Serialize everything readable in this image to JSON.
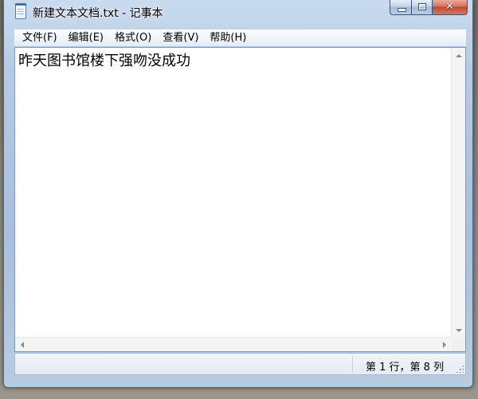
{
  "window": {
    "title": "新建文本文档.txt - 记事本",
    "close_glyph": "✕"
  },
  "menu": {
    "items": [
      {
        "label": "文件(F)"
      },
      {
        "label": "编辑(E)"
      },
      {
        "label": "格式(O)"
      },
      {
        "label": "查看(V)"
      },
      {
        "label": "帮助(H)"
      }
    ]
  },
  "editor": {
    "content": "昨天图书馆楼下强吻没成功"
  },
  "statusbar": {
    "position": "第 1 行，第 8 列"
  },
  "colors": {
    "accent": "#3f6fb5",
    "close_button": "#c24a33"
  },
  "icons": {
    "app": "notepad-icon",
    "minimize": "minimize-icon",
    "maximize": "maximize-icon",
    "close": "close-icon"
  }
}
